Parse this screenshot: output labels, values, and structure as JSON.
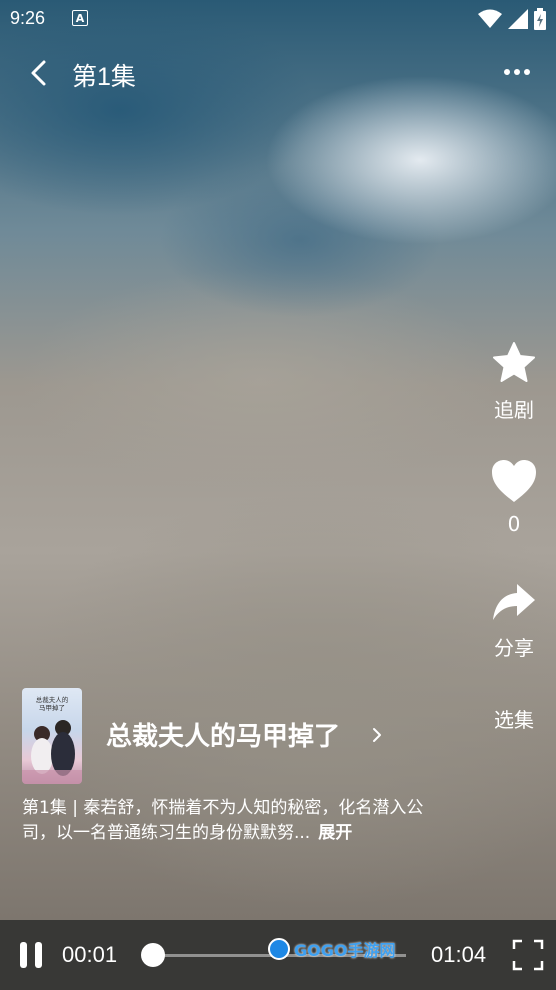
{
  "status_bar": {
    "time": "9:26",
    "notification_icon": "A"
  },
  "header": {
    "title": "第1集"
  },
  "side_actions": [
    {
      "label": "追剧",
      "icon": "star-icon"
    },
    {
      "label": "0",
      "icon": "heart-icon"
    },
    {
      "label": "分享",
      "icon": "share-icon"
    },
    {
      "label": "选集"
    }
  ],
  "drama": {
    "title": "总裁夫人的马甲掉了",
    "poster_text": "总裁夫人的马甲掉了",
    "description": "第1集 | 秦若舒，怀揣着不为人知的秘密，化名潜入公司，以一名普通练习生的身份默默努...",
    "expand_label": "展开"
  },
  "player": {
    "current_time": "00:01",
    "total_time": "01:04",
    "progress": 0.0
  },
  "watermark": {
    "text": "GOGO手游网"
  }
}
